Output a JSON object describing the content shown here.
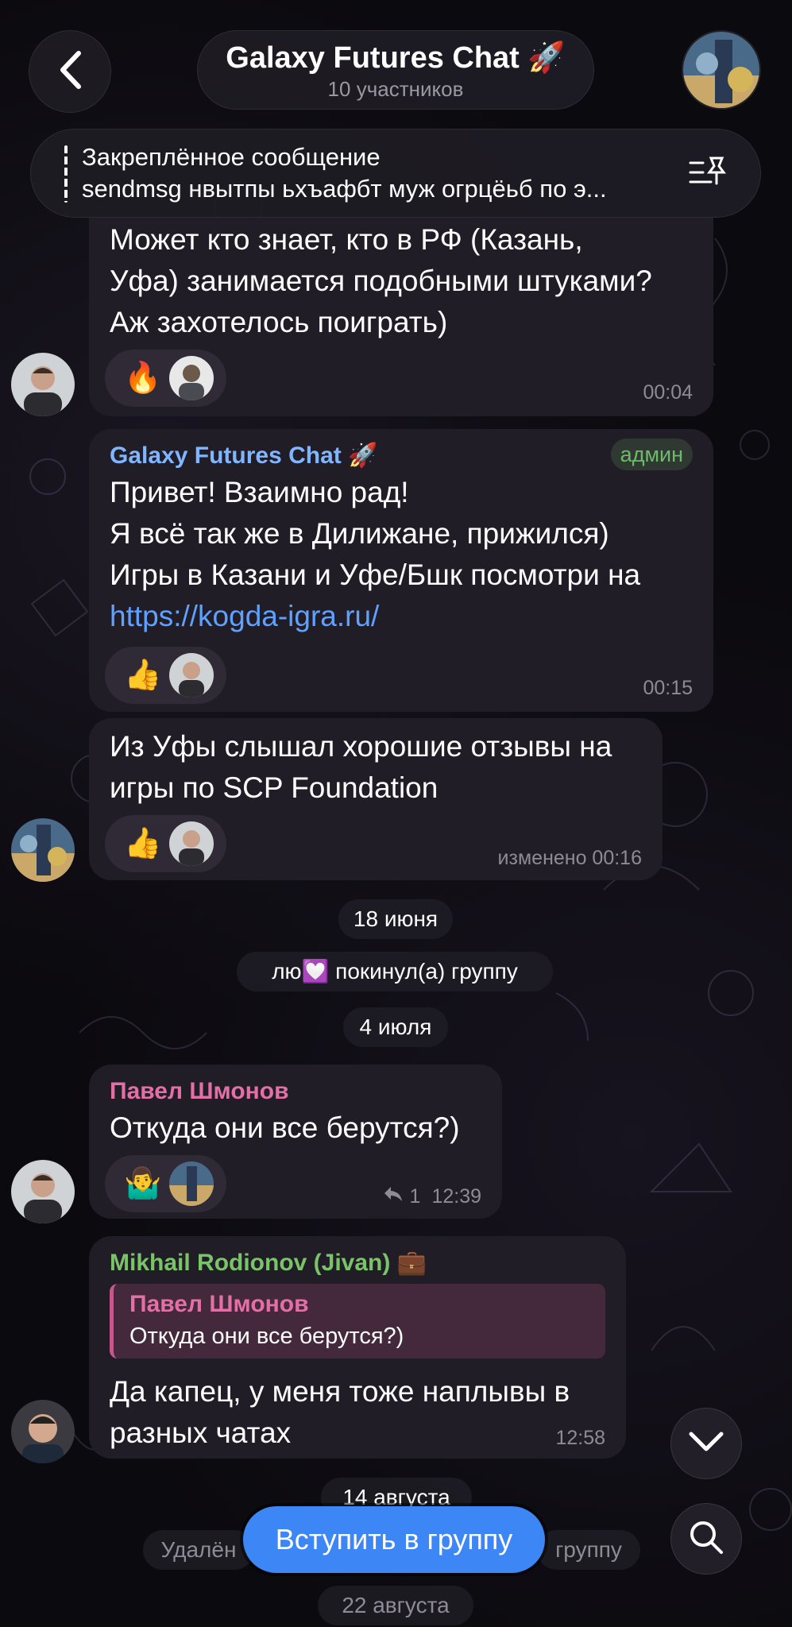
{
  "header": {
    "title": "Galaxy Futures Chat 🚀",
    "subtitle": "10 участников"
  },
  "pinned": {
    "title": "Закреплённое сообщение",
    "text": "sendmsg нвытпы ьхъафбт муж огрцёьб по э..."
  },
  "messages": [
    {
      "text_lines": [
        "Может кто знает, кто в РФ (Казань,",
        "Уфа) занимается подобными штуками?",
        "Аж захотелось поиграть)"
      ],
      "reaction": "🔥",
      "time": "00:04"
    },
    {
      "sender": "Galaxy Futures Chat 🚀",
      "badge": "админ",
      "text_lines": [
        "Привет! Взаимно рад!",
        "Я всё так же в Дилижане, прижился)",
        "Игры в Казани и Уфе/Бшк посмотри на"
      ],
      "link": "https://kogda-igra.ru/",
      "reaction": "👍",
      "time": "00:15"
    },
    {
      "text_lines": [
        "Из Уфы слышал хорошие отзывы на",
        "игры по SCP Foundation"
      ],
      "reaction": "👍",
      "time": "изменено 00:16"
    },
    {
      "sender": "Павел Шмонов",
      "text_lines": [
        "Откуда они все берутся?)"
      ],
      "reaction": "🤷‍♂️",
      "reply_count": "1",
      "time": "12:39"
    },
    {
      "sender": "Mikhail Rodionov (Jivan) 💼",
      "quote_sender": "Павел Шмонов",
      "quote_text": "Откуда они все берутся?)",
      "text_lines": [
        "Да капец, у меня тоже наплывы в",
        "разных чатах"
      ],
      "time": "12:58"
    }
  ],
  "service": {
    "date1": "18 июня",
    "left_group": "лю💟 покинул(а) группу",
    "date2": "4 июля",
    "date3": "14 августа",
    "deleted_left": "Удалён",
    "deleted_right": "группу",
    "date4": "22 августа"
  },
  "join_button": "Вступить в группу",
  "colors": {
    "accent": "#3d86f5",
    "admin_name": "#7fb6ff",
    "admin_badge": "#6dbb6a",
    "pavel_name": "#e36fa6",
    "mikhail_name": "#7ac369",
    "link": "#5ea1ff"
  },
  "icons": [
    "back-chevron-icon",
    "pin-list-icon",
    "reply-arrow-icon",
    "scroll-down-icon",
    "search-icon"
  ]
}
